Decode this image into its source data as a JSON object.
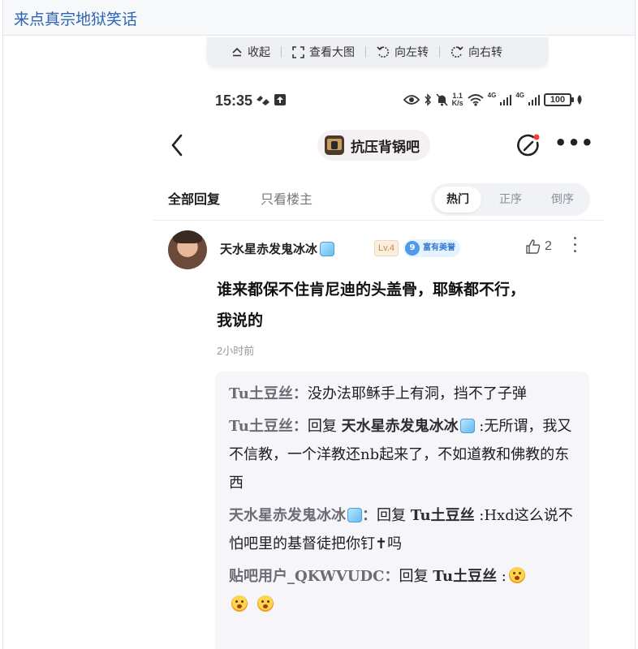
{
  "page": {
    "title": "来点真宗地狱笑话"
  },
  "toolbar": {
    "collapse": "收起",
    "view_large": "查看大图",
    "rotate_left": "向左转",
    "rotate_right": "向右转"
  },
  "status_bar": {
    "time": "15:35",
    "speed_top": "1.1",
    "speed_unit": "K/s",
    "net1": "4G",
    "net2": "4G",
    "battery": "100"
  },
  "nav": {
    "forum_name": "抗压背锅吧"
  },
  "tabs": {
    "all_replies": "全部回复",
    "op_only": "只看楼主",
    "sort_hot": "热门",
    "sort_asc": "正序",
    "sort_desc": "倒序"
  },
  "post": {
    "username": "天水星赤发鬼冰冰",
    "level": "Lv.4",
    "honor_num": "9",
    "honor_label": "富有美誉",
    "likes": "2",
    "body_line1": "谁来都保不住肯尼迪的头盖骨，耶稣都不行，",
    "body_line2": "我说的",
    "time": "2小时前"
  },
  "replies": [
    {
      "who": "Tu土豆丝：",
      "text": "没办法耶稣手上有洞，挡不了子弹"
    },
    {
      "who": "Tu土豆丝：",
      "reply_prefix": "回复 ",
      "to": "天水星赤发鬼冰冰",
      "text": " :无所谓，我又不信教，一个洋教还nb起来了，不如道教和佛教的东西"
    },
    {
      "who": "天水星赤发鬼冰冰",
      "who_suffix": "：",
      "reply_prefix": "回复 ",
      "to": "Tu土豆丝",
      "text": " :Hxd这么说不怕吧里的基督徒把你钉✝吗"
    },
    {
      "who": "贴吧用户_QKWVUDC：",
      "reply_prefix": "回复 ",
      "to": "Tu土豆丝",
      "text": " :"
    }
  ],
  "icons": {
    "collapse": "chevron-up-icon",
    "view_large": "expand-icon",
    "rotate_left": "rotate-left-icon",
    "rotate_right": "rotate-right-icon"
  },
  "colors": {
    "link_blue": "#2d64b3",
    "reply_bg": "#f5f5fa",
    "notify_red": "#ff3b30"
  }
}
